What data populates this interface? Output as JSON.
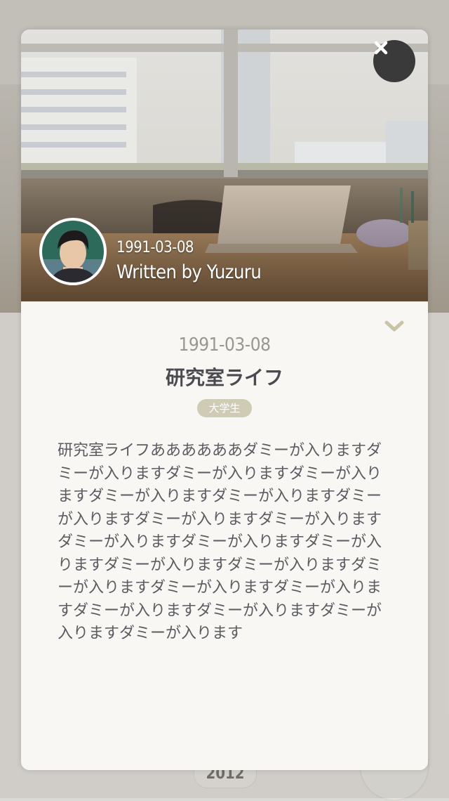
{
  "background": {
    "year_label": "2012"
  },
  "modal": {
    "close_icon": "close-icon",
    "hero": {
      "date": "1991-03-08",
      "author": "Written by Yuzuru"
    },
    "collapse_icon": "chevron-down-icon",
    "entry": {
      "date": "1991-03-08",
      "title": "研究室ライフ",
      "tag": "大学生",
      "body": "研究室ライフああああああダミーが入りますダミーが入りますダミーが入りますダミーが入りますダミーが入りますダミーが入りますダミーが入りますダミーが入りますダミーが入りますダミーが入りますダミーが入りますダミーが入りますダミーが入りますダミーが入りますダミーが入りますダミーが入りますダミーが入りますダミーが入りますダミーが入りますダミーが入りますダミーが入ります"
    }
  },
  "colors": {
    "accent_tag": "#cfcbb5",
    "close_button": "#3a3a3a",
    "chevron": "#c9c4a8",
    "title_text": "#4a4a50"
  }
}
